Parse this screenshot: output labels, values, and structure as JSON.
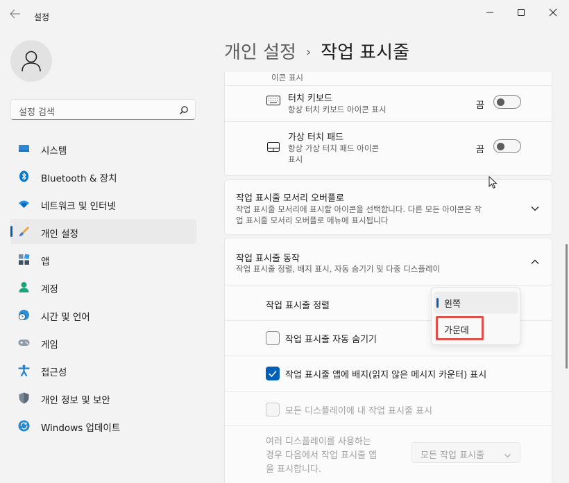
{
  "window": {
    "title": "설정"
  },
  "search": {
    "placeholder": "설정 검색"
  },
  "sidebar": {
    "items": [
      {
        "label": "시스템",
        "icon": "monitor-icon"
      },
      {
        "label": "Bluetooth & 장치",
        "icon": "bluetooth-icon"
      },
      {
        "label": "네트워크 및 인터넷",
        "icon": "wifi-icon"
      },
      {
        "label": "개인 설정",
        "icon": "brush-icon",
        "active": true
      },
      {
        "label": "앱",
        "icon": "apps-icon"
      },
      {
        "label": "계정",
        "icon": "person-icon"
      },
      {
        "label": "시간 및 언어",
        "icon": "globe-clock-icon"
      },
      {
        "label": "게임",
        "icon": "gamepad-icon"
      },
      {
        "label": "접근성",
        "icon": "accessibility-icon"
      },
      {
        "label": "개인 정보 및 보안",
        "icon": "shield-icon"
      },
      {
        "label": "Windows 업데이트",
        "icon": "update-icon"
      }
    ]
  },
  "header": {
    "parent": "개인 설정",
    "separator": "›",
    "current": "작업 표시줄"
  },
  "pen_card": {
    "desc_tail": "이콘 표시"
  },
  "touch_keyboard": {
    "title": "터치 키보드",
    "desc": "항상 터치 키보드 아이콘 표시",
    "state": "끔"
  },
  "virtual_touchpad": {
    "title": "가상 터치 패드",
    "desc_line1": "항상 가상 터치 패드 아이콘",
    "desc_line2": "표시",
    "state": "끔"
  },
  "overflow": {
    "title": "작업 표시줄 모서리 오버플로",
    "desc_line1": "작업 표시줄 모서리에 표시할 아이콘을 선택합니다. 다른 모든 아이콘은 작",
    "desc_line2": "업 표시줄 모서리 오버플로 메뉴에 표시됩니다"
  },
  "behaviors": {
    "title": "작업 표시줄 동작",
    "desc": "작업 표시줄 정렬, 배지 표시, 자동 숨기기 및 다중 디스플레이",
    "alignment_label": "작업 표시줄 정렬",
    "alignment_options": [
      "왼쪽",
      "가운데"
    ],
    "alignment_selected": "왼쪽",
    "autohide_label": "작업 표시줄 자동 숨기기",
    "autohide_checked": false,
    "badges_label": "작업 표시줄 앱에 배지(읽지 않은 메시지 카운터) 표시",
    "badges_checked": true,
    "all_displays_label": "모든 디스플레이에 내 작업 표시줄 표시",
    "all_displays_checked": false,
    "multi_line1": "여러 디스플레이를 사용하는",
    "multi_line2": "경우 다음에서 작업 표시줄 앱",
    "multi_line3": "을 표시합니다.",
    "multi_value": "모든 작업 표시줄"
  },
  "colors": {
    "accent": "#005fb8",
    "highlight": "#e0504a"
  }
}
